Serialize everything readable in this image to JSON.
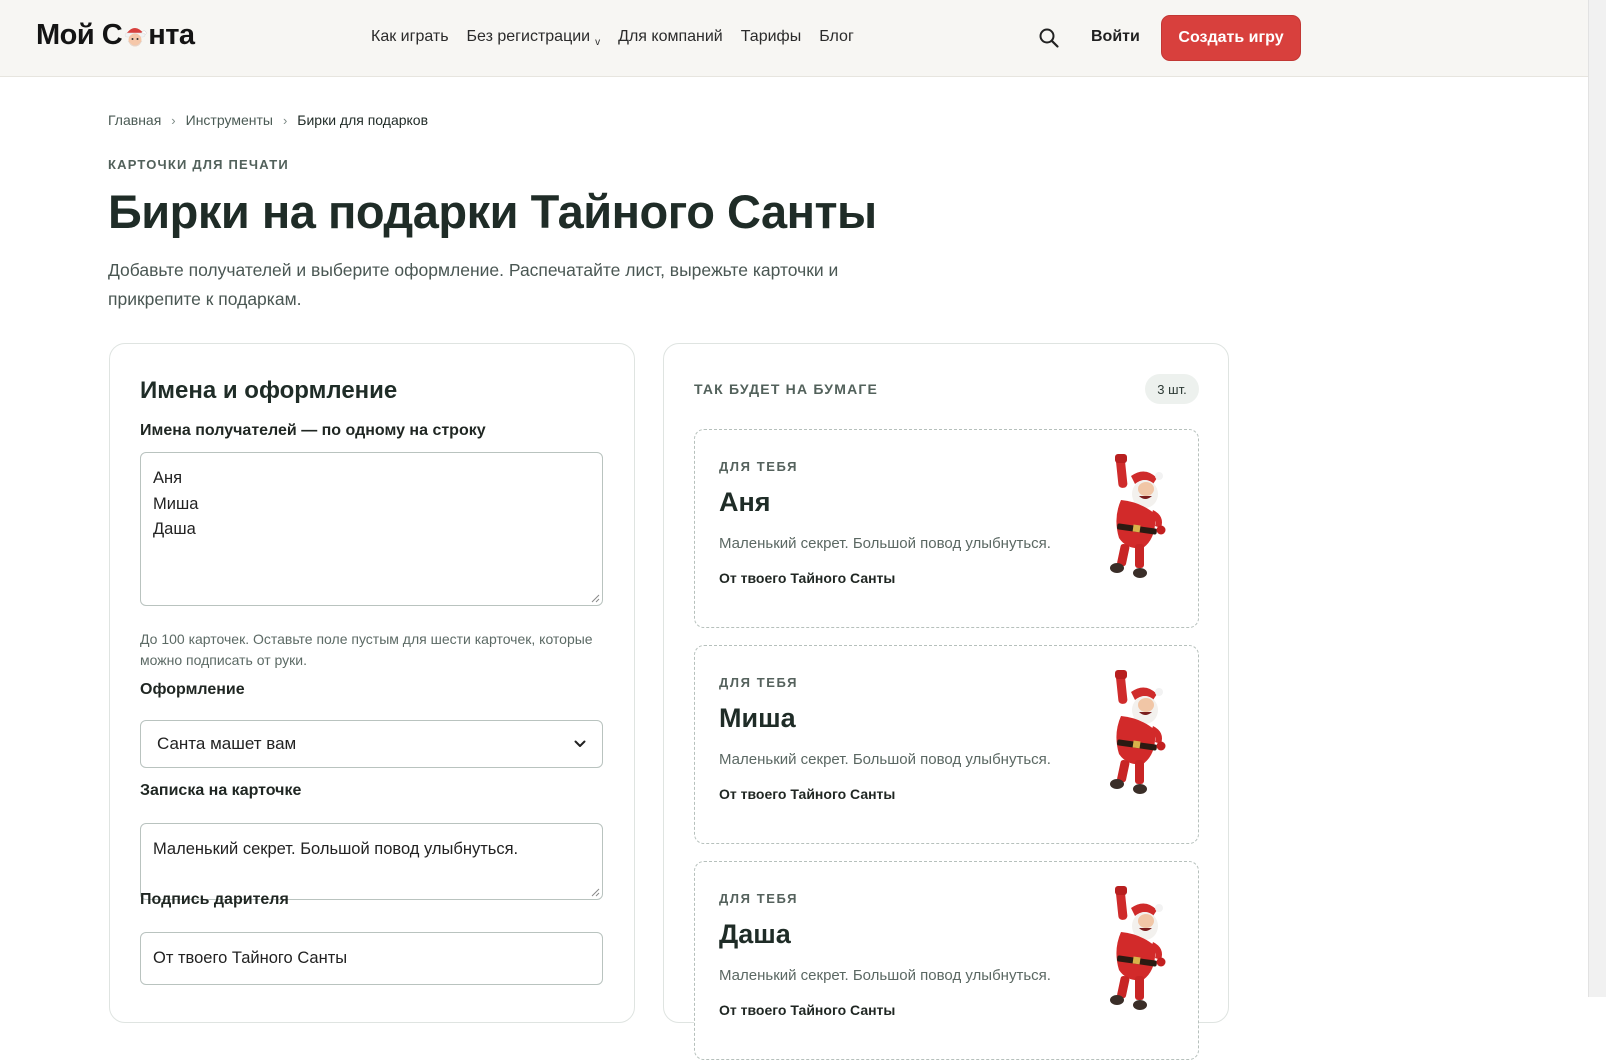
{
  "header": {
    "logo_left": "Мой С",
    "logo_right": "нта",
    "nav": [
      {
        "label": "Как играть"
      },
      {
        "label": "Без регистрации",
        "chevron": "v"
      },
      {
        "label": "Для компаний"
      },
      {
        "label": "Тарифы"
      },
      {
        "label": "Блог"
      }
    ],
    "search_icon": "search-icon",
    "login": "Войти",
    "create_game": "Создать игру"
  },
  "breadcrumb": {
    "items": [
      "Главная",
      "Инструменты",
      "Бирки для подарков"
    ],
    "separator": "›"
  },
  "hero": {
    "eyebrow": "КАРТОЧКИ ДЛЯ ПЕЧАТИ",
    "title": "Бирки на подарки Тайного Санты",
    "lead": "Добавьте получателей и выберите оформление. Распечатайте лист, вырежьте карточки и прикрепите к подаркам."
  },
  "form": {
    "title": "Имена и оформление",
    "names_label": "Имена получателей — по одному на строку",
    "names": [
      "Аня",
      "Миша",
      "Даша"
    ],
    "names_hint": "До 100 карточек. Оставьте поле пустым для шести карточек, которые можно подписать от руки.",
    "design_label": "Оформление",
    "design_value": "Санта машет вам",
    "note_label": "Записка на карточке",
    "note_value": "Маленький секрет. Большой повод улыбнуться.",
    "sign_label": "Подпись дарителя",
    "sign_value": "От твоего Тайного Санты"
  },
  "preview": {
    "title": "ТАК БУДЕТ НА БУМАГЕ",
    "count": "3 шт.",
    "cards": [
      {
        "eyebrow": "ДЛЯ ТЕБЯ",
        "name": "Аня",
        "note": "Маленький секрет. Большой повод улыбнуться.",
        "sign": "От твоего Тайного Санты"
      },
      {
        "eyebrow": "ДЛЯ ТЕБЯ",
        "name": "Миша",
        "note": "Маленький секрет. Большой повод улыбнуться.",
        "sign": "От твоего Тайного Санты"
      },
      {
        "eyebrow": "ДЛЯ ТЕБЯ",
        "name": "Даша",
        "note": "Маленький секрет. Большой повод улыбнуться.",
        "sign": "От твоего Тайного Санты"
      }
    ]
  },
  "colors": {
    "accent": "#d8403d",
    "text": "#1f2c27",
    "muted": "#52615b",
    "border": "#dfe4e1"
  }
}
